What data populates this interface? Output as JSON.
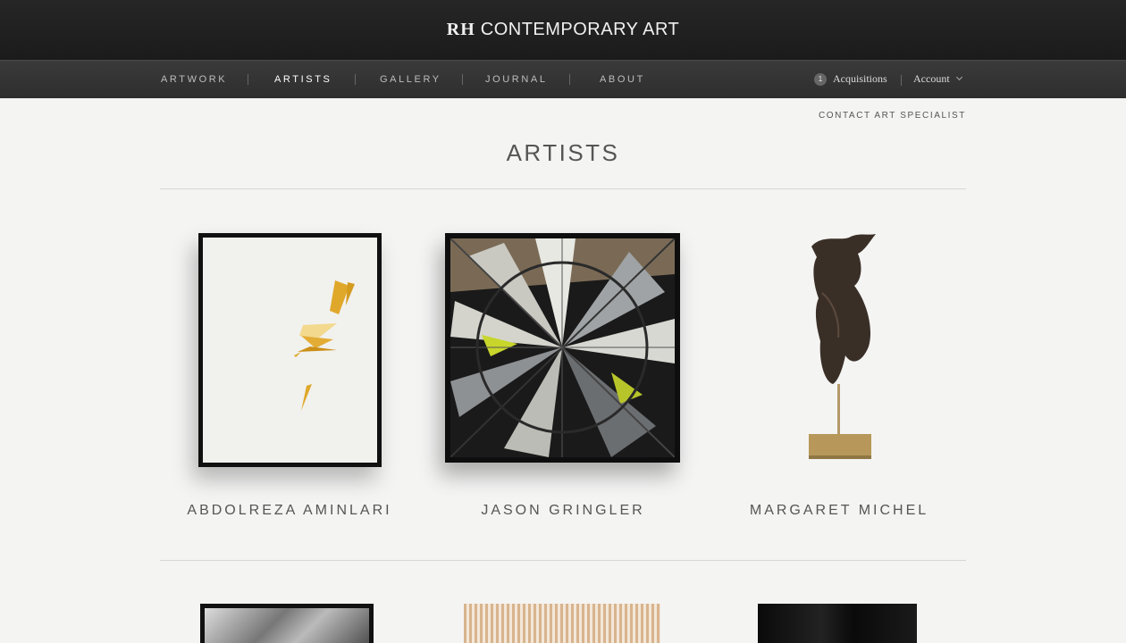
{
  "header": {
    "brand_rh": "RH",
    "brand_name": "CONTEMPORARY ART"
  },
  "nav": {
    "items": [
      {
        "label": "ARTWORK",
        "active": false
      },
      {
        "label": "ARTISTS",
        "active": true
      },
      {
        "label": "GALLERY",
        "active": false
      },
      {
        "label": "JOURNAL",
        "active": false
      },
      {
        "label": "ABOUT",
        "active": false
      }
    ],
    "acquisitions_count": "1",
    "acquisitions_label": "Acquisitions",
    "account_label": "Account"
  },
  "contact_link": "CONTACT ART SPECIALIST",
  "page_title": "ARTISTS",
  "artists": [
    {
      "name": "ABDOLREZA AMINLARI"
    },
    {
      "name": "JASON GRINGLER"
    },
    {
      "name": "MARGARET MICHEL"
    }
  ],
  "colors": {
    "topbar": "#1f1f1f",
    "navbar": "#333333",
    "page_bg": "#f4f4f3",
    "accent_yellow": "#e0a82a"
  }
}
